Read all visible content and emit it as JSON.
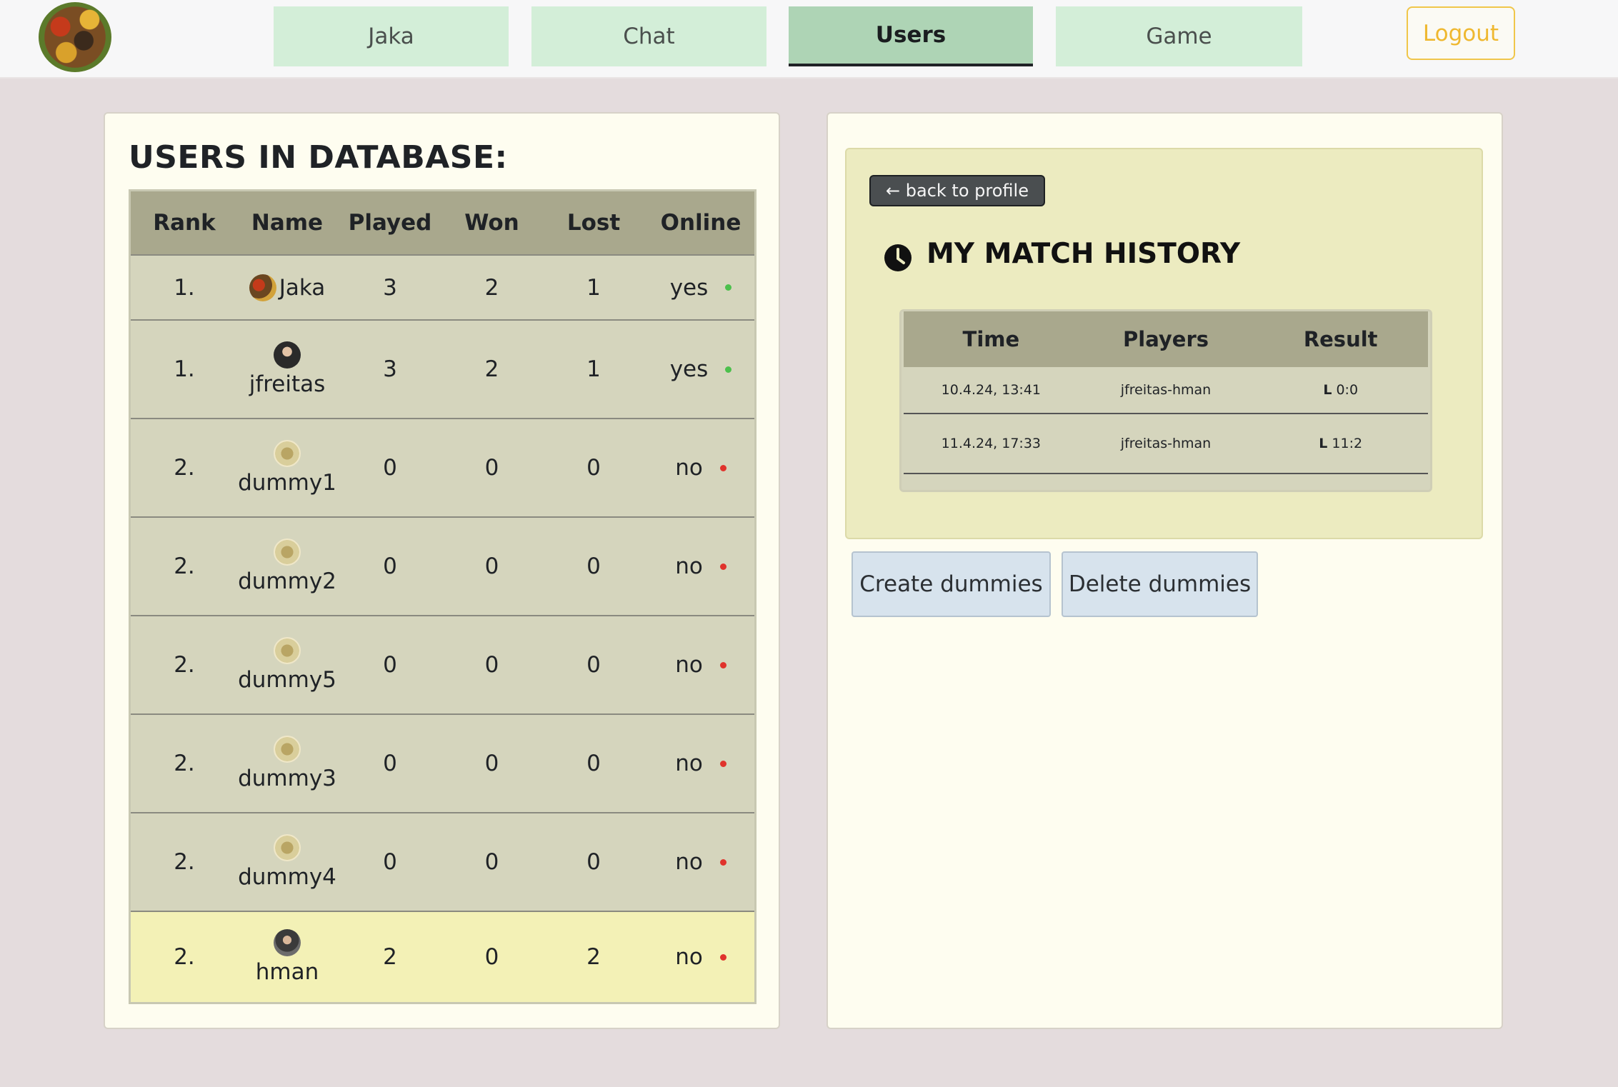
{
  "nav": {
    "logo_icon": "app-logo",
    "tabs": [
      {
        "label": "Jaka"
      },
      {
        "label": "Chat"
      },
      {
        "label": "Users"
      },
      {
        "label": "Game"
      }
    ],
    "active_tab": "Users",
    "logout_label": "Logout"
  },
  "users_panel": {
    "title": "USERS IN DATABASE:",
    "columns": [
      "Rank",
      "Name",
      "Played",
      "Won",
      "Lost",
      "Online"
    ],
    "rows": [
      {
        "rank": "1.",
        "name": "Jaka",
        "played": "3",
        "won": "2",
        "lost": "1",
        "online": "yes"
      },
      {
        "rank": "1.",
        "name": "jfreitas",
        "played": "3",
        "won": "2",
        "lost": "1",
        "online": "yes"
      },
      {
        "rank": "2.",
        "name": "dummy1",
        "played": "0",
        "won": "0",
        "lost": "0",
        "online": "no"
      },
      {
        "rank": "2.",
        "name": "dummy2",
        "played": "0",
        "won": "0",
        "lost": "0",
        "online": "no"
      },
      {
        "rank": "2.",
        "name": "dummy5",
        "played": "0",
        "won": "0",
        "lost": "0",
        "online": "no"
      },
      {
        "rank": "2.",
        "name": "dummy3",
        "played": "0",
        "won": "0",
        "lost": "0",
        "online": "no"
      },
      {
        "rank": "2.",
        "name": "dummy4",
        "played": "0",
        "won": "0",
        "lost": "0",
        "online": "no"
      },
      {
        "rank": "2.",
        "name": "hman",
        "played": "2",
        "won": "0",
        "lost": "2",
        "online": "no"
      }
    ]
  },
  "history_panel": {
    "back_label": "← back to profile",
    "title": "MY MATCH HISTORY",
    "columns": [
      "Time",
      "Players",
      "Result"
    ],
    "rows": [
      {
        "time": "10.4.24, 13:41",
        "players": "jfreitas-hman",
        "result_flag": "L",
        "result_score": "0:0"
      },
      {
        "time": "11.4.24, 17:33",
        "players": "jfreitas-hman",
        "result_flag": "L",
        "result_score": "11:2"
      }
    ],
    "create_label": "Create dummies",
    "delete_label": "Delete dummies"
  },
  "colors": {
    "background": "#e4dcdd",
    "nav_tab": "#d3eed8",
    "nav_tab_active": "#aed4b5",
    "logout_accent": "#efb830",
    "online": "#4cc04c",
    "offline": "#e0332c",
    "current_user_row": "#f3f1b6"
  }
}
